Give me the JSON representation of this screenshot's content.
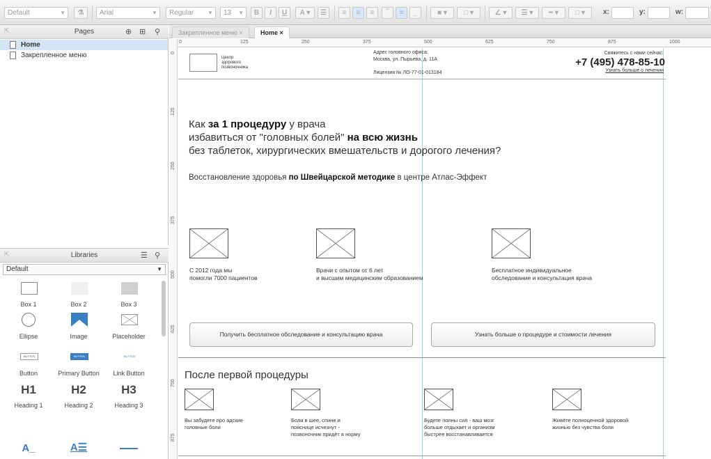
{
  "toolbar": {
    "style_select": "Default",
    "font_select": "Arial",
    "weight_select": "Regular",
    "size_select": "13",
    "bold": "B",
    "italic": "I",
    "underline": "U",
    "x_label": "x:",
    "y_label": "y:",
    "w_label": "w:"
  },
  "pages": {
    "title": "Pages",
    "items": [
      {
        "label": "Home"
      },
      {
        "label": "Закрепленное меню"
      }
    ]
  },
  "libraries": {
    "title": "Libraries",
    "selected": "Default",
    "items": [
      {
        "label": "Box 1"
      },
      {
        "label": "Box 2"
      },
      {
        "label": "Box 3"
      },
      {
        "label": "Ellipse"
      },
      {
        "label": "Image"
      },
      {
        "label": "Placeholder"
      },
      {
        "label": "Button"
      },
      {
        "label": "Primary Button"
      },
      {
        "label": "Link Button"
      },
      {
        "label": "Heading 1"
      },
      {
        "label": "Heading 2"
      },
      {
        "label": "Heading 3"
      }
    ],
    "button_preview": "BUTTON",
    "heading_previews": [
      "H1",
      "H2",
      "H3"
    ]
  },
  "tabs": [
    {
      "label": "Закрепленное меню ×"
    },
    {
      "label": "Home ×"
    }
  ],
  "ruler": {
    "top": [
      "0",
      "125",
      "250",
      "375",
      "500",
      "625",
      "750",
      "875",
      "1000"
    ],
    "left": [
      "0",
      "125",
      "250",
      "375",
      "500",
      "625",
      "750",
      "875"
    ]
  },
  "page": {
    "logo_text": "Центр здорового позвоночника",
    "address_title": "Адрес головного офиса:",
    "address_line": "Москва, ул. Пырьева, д. 11А",
    "license": "Лицензия № ЛО-77-01-013184",
    "contact_label": "Свяжитесь с нами сейчас:",
    "phone": "+7 (495) 478-85-10",
    "contact_link": "Узнать больше о лечении",
    "headline_1a": "Как ",
    "headline_1b": "за 1 процедуру",
    "headline_1c": " у врача",
    "headline_2a": "избавиться от \"головных болей\" ",
    "headline_2b": "на всю жизнь",
    "headline_3": "без таблеток, хирургических вмешательств и дорогого лечения?",
    "subhead_a": "Восстановление здоровья ",
    "subhead_b": "по Швейцарской методике",
    "subhead_c": " в центре Атлас-Эффект",
    "features": [
      {
        "line1": "С 2012 года мы",
        "line2": "помогли 7000 пациентов"
      },
      {
        "line1": "Врачи с опытом от 6 лет",
        "line2": "и высшим медицинским образованием"
      },
      {
        "line1": "Бесплатное индивидуальное",
        "line2": "обследование и консультация врача"
      }
    ],
    "cta_1": "Получить бесплатное обследование и консультацию врача",
    "cta_2": "Узнать больше о процедуре и стоимости лечения",
    "section_title": "После первой процедуры",
    "results": [
      {
        "line1": "Вы забудете про адские",
        "line2": "головные боли",
        "line3": ""
      },
      {
        "line1": "Боли в шее, спине и",
        "line2": "пояснице исчезнут -",
        "line3": "позвоночник придёт в норму"
      },
      {
        "line1": "Будете полны сил - ваш мозг",
        "line2": "больше отдыхает и организм",
        "line3": "быстрее восстанавливается"
      },
      {
        "line1": "Живёте полноценной здоровой",
        "line2": "жизнью без чувства боли",
        "line3": ""
      }
    ]
  }
}
